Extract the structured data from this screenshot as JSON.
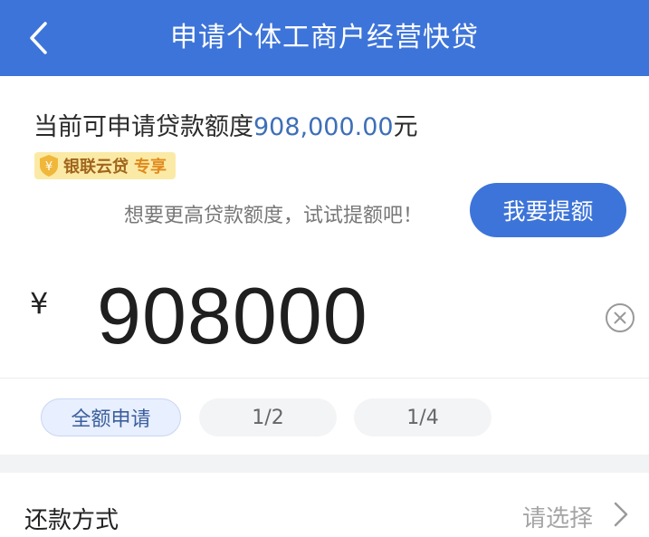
{
  "nav": {
    "title": "申请个体工商户经营快贷"
  },
  "quota": {
    "label": "当前可申请贷款额度",
    "amount": "908,000.00",
    "unit": "元"
  },
  "badge": {
    "brand": "银联云贷",
    "tag": "专享"
  },
  "raise": {
    "hint": "想要更高贷款额度，试试提额吧！",
    "button": "我要提额"
  },
  "amount": {
    "currency": "¥",
    "value": "908000"
  },
  "chips": [
    {
      "label": "全额申请",
      "selected": true
    },
    {
      "label": "1/2",
      "selected": false
    },
    {
      "label": "1/4",
      "selected": false
    }
  ],
  "repayment": {
    "label": "还款方式",
    "value": "请选择"
  },
  "colors": {
    "primary": "#3d74d9",
    "amount": "#3d6fb8",
    "badge_bg": "#fbeaa6"
  },
  "icons": [
    "back-icon",
    "shield-icon",
    "clear-icon",
    "chevron-right-icon"
  ]
}
